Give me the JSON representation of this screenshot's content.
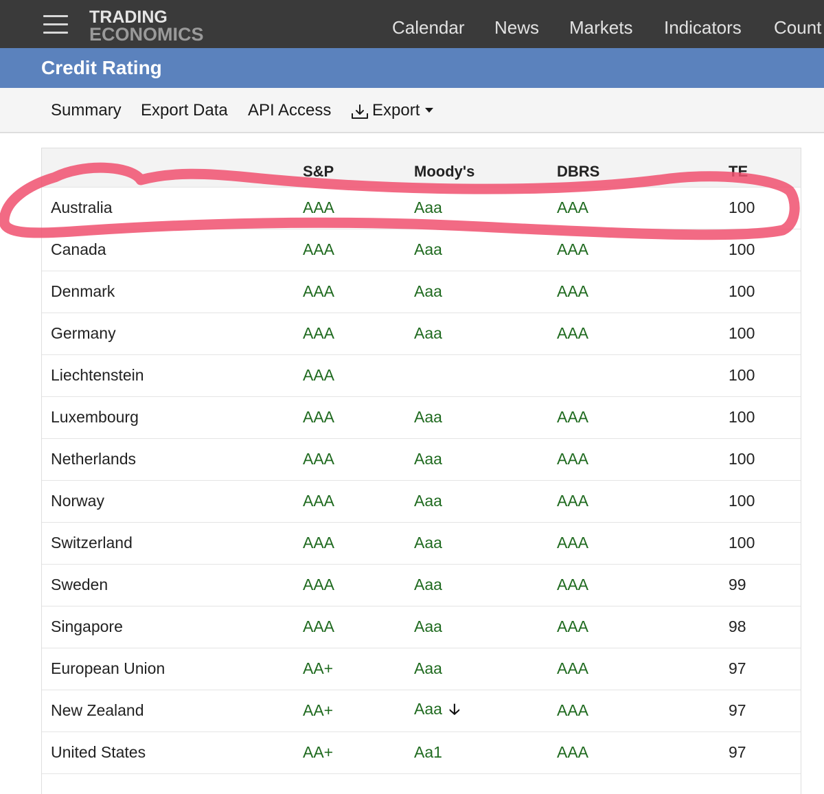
{
  "navbar": {
    "logo_line1": "TRADING",
    "logo_line2": "ECONOMICS",
    "links": [
      "Calendar",
      "News",
      "Markets",
      "Indicators",
      "Count"
    ]
  },
  "title": "Credit Rating",
  "subnav": {
    "summary": "Summary",
    "export_data": "Export Data",
    "api_access": "API Access",
    "export": "Export"
  },
  "table": {
    "headers": [
      "",
      "S&P",
      "Moody's",
      "DBRS",
      "TE"
    ],
    "rows": [
      {
        "country": "Australia",
        "sp": "AAA",
        "moodys": "Aaa",
        "dbrs": "AAA",
        "te": "100"
      },
      {
        "country": "Canada",
        "sp": "AAA",
        "moodys": "Aaa",
        "dbrs": "AAA",
        "te": "100"
      },
      {
        "country": "Denmark",
        "sp": "AAA",
        "moodys": "Aaa",
        "dbrs": "AAA",
        "te": "100"
      },
      {
        "country": "Germany",
        "sp": "AAA",
        "moodys": "Aaa",
        "dbrs": "AAA",
        "te": "100"
      },
      {
        "country": "Liechtenstein",
        "sp": "AAA",
        "moodys": "",
        "dbrs": "",
        "te": "100"
      },
      {
        "country": "Luxembourg",
        "sp": "AAA",
        "moodys": "Aaa",
        "dbrs": "AAA",
        "te": "100"
      },
      {
        "country": "Netherlands",
        "sp": "AAA",
        "moodys": "Aaa",
        "dbrs": "AAA",
        "te": "100"
      },
      {
        "country": "Norway",
        "sp": "AAA",
        "moodys": "Aaa",
        "dbrs": "AAA",
        "te": "100"
      },
      {
        "country": "Switzerland",
        "sp": "AAA",
        "moodys": "Aaa",
        "dbrs": "AAA",
        "te": "100"
      },
      {
        "country": "Sweden",
        "sp": "AAA",
        "moodys": "Aaa",
        "dbrs": "AAA",
        "te": "99"
      },
      {
        "country": "Singapore",
        "sp": "AAA",
        "moodys": "Aaa",
        "dbrs": "AAA",
        "te": "98"
      },
      {
        "country": "European Union",
        "sp": "AA+",
        "moodys": "Aaa",
        "dbrs": "AAA",
        "te": "97"
      },
      {
        "country": "New Zealand",
        "sp": "AA+",
        "moodys": "Aaa",
        "dbrs": "AAA",
        "te": "97"
      },
      {
        "country": "United States",
        "sp": "AA+",
        "moodys": "Aa1",
        "dbrs": "AAA",
        "te": "97"
      }
    ]
  },
  "icons": {
    "menu": "hamburger-menu-icon",
    "export": "download-icon",
    "caret": "caret-down-icon",
    "outlook_down": "arrow-down-icon"
  },
  "colors": {
    "navbar_bg": "#3a3a3a",
    "title_bg": "#5b82bd",
    "rating_green": "#1f6a1f",
    "highlight_red": "#f0506e"
  }
}
